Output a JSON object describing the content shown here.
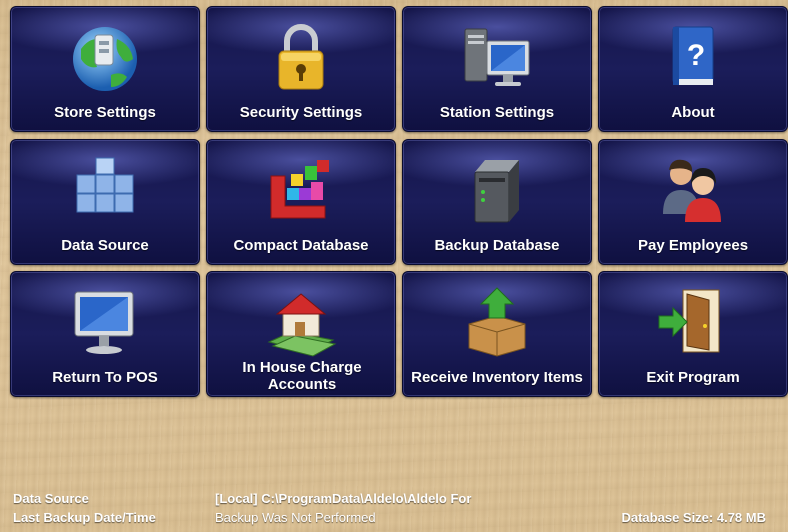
{
  "tiles": [
    {
      "label": "Store Settings",
      "icon": "globe-icon"
    },
    {
      "label": "Security Settings",
      "icon": "padlock-icon"
    },
    {
      "label": "Station Settings",
      "icon": "computer-icon"
    },
    {
      "label": "About",
      "icon": "help-book-icon"
    },
    {
      "label": "Data Source",
      "icon": "cubes-icon"
    },
    {
      "label": "Compact Database",
      "icon": "blocks-icon"
    },
    {
      "label": "Backup Database",
      "icon": "server-icon"
    },
    {
      "label": "Pay Employees",
      "icon": "people-icon"
    },
    {
      "label": "Return To POS",
      "icon": "monitor-icon"
    },
    {
      "label": "In House Charge Accounts",
      "icon": "house-money-icon"
    },
    {
      "label": "Receive Inventory Items",
      "icon": "box-arrow-icon"
    },
    {
      "label": "Exit Program",
      "icon": "exit-door-icon"
    }
  ],
  "footer": {
    "data_source_label": "Data Source",
    "data_source_value": "[Local] C:\\ProgramData\\Aldelo\\Aldelo For",
    "last_backup_label": "Last Backup Date/Time",
    "last_backup_value": "Backup Was Not Performed",
    "database_size": "Database Size: 4.78 MB"
  }
}
